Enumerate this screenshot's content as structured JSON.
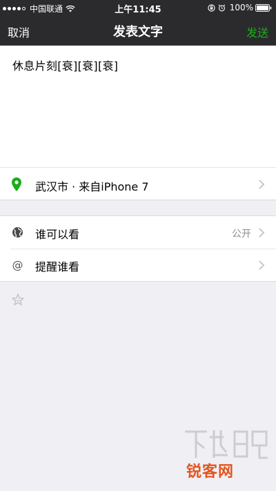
{
  "status_bar": {
    "carrier": "中国联通",
    "time": "上午11:45",
    "battery": "100%"
  },
  "nav": {
    "cancel": "取消",
    "title": "发表文字",
    "send": "发送"
  },
  "compose": {
    "text": "休息片刻[衰][衰][衰]"
  },
  "location": {
    "label": "武汉市 · 来自iPhone 7"
  },
  "settings": {
    "visibility_label": "谁可以看",
    "visibility_value": "公开",
    "mention_label": "提醒谁看"
  },
  "watermark": {
    "text": "锐客网"
  },
  "colors": {
    "nav_bg": "#2b2b2d",
    "accent_green": "#1aad19",
    "page_bg": "#efeff4"
  }
}
